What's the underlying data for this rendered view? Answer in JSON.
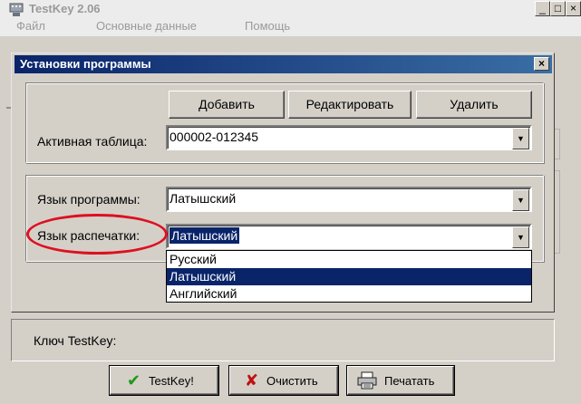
{
  "main_window": {
    "title": "TestKey 2.06",
    "menu": [
      "Файл",
      "Основные данные",
      "Помощь"
    ],
    "controls": {
      "minimize": "_",
      "maximize": "□",
      "close": "×"
    }
  },
  "dialog": {
    "title": "Установки программы",
    "close": "×",
    "buttons": {
      "add": "Добавить",
      "edit": "Редактировать",
      "delete": "Удалить"
    },
    "active_table_label": "Активная таблица:",
    "active_table_value": "000002-012345",
    "program_language_label": "Язык программы:",
    "program_language_value": "Латышский",
    "print_language_label": "Язык распечатки:",
    "print_language_value": "Латышский",
    "dropdown_options": [
      "Русский",
      "Латышский",
      "Английский"
    ],
    "dropdown_selected": "Латышский"
  },
  "bottom": {
    "key_label": "Ключ TestKey:",
    "buttons": {
      "testkey": "TestKey!",
      "clear": "Очистить",
      "print": "Печатать"
    }
  },
  "icons": {
    "app": "keyboard-icon",
    "dropdown_arrow": "▼",
    "testkey": "✔",
    "clear": "✘",
    "print": "printer-icon"
  },
  "colors": {
    "selection": "#0a246a",
    "annotation": "#dd1020",
    "check": "#1a9a1a",
    "cross": "#c01010"
  }
}
